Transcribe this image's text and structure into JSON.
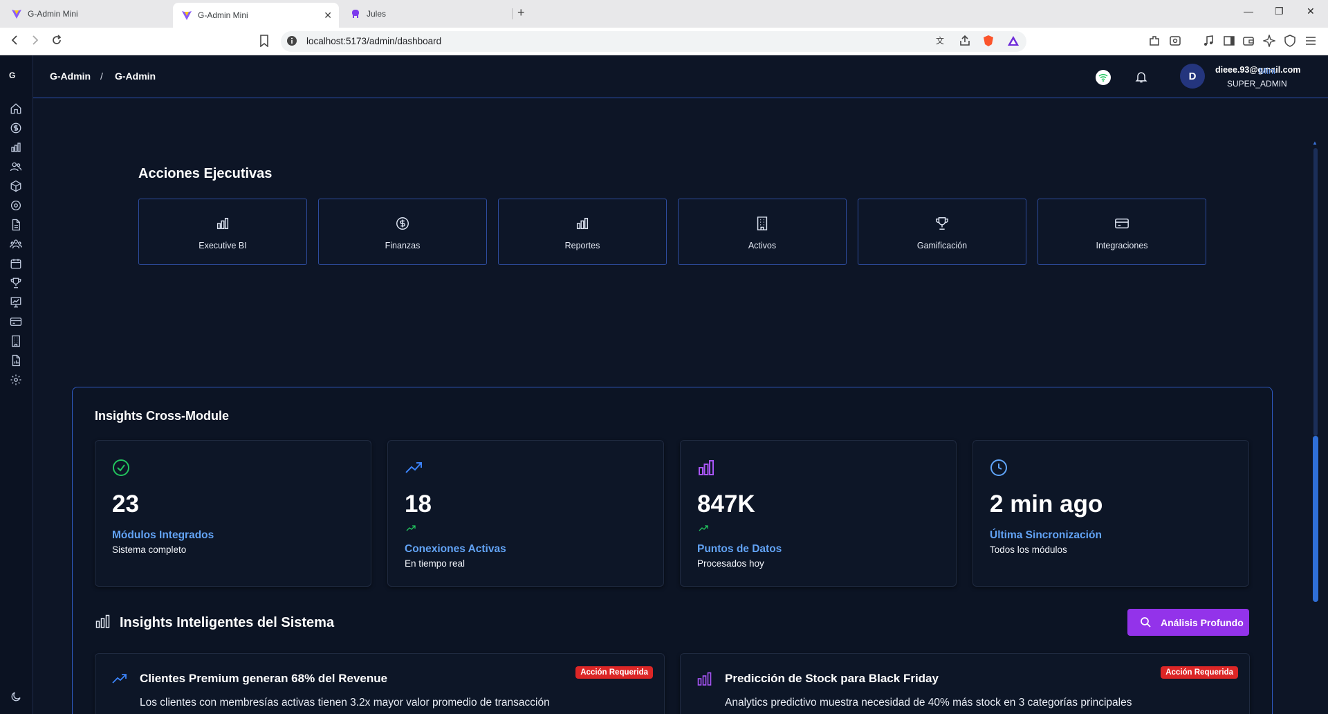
{
  "browser": {
    "tabs": [
      {
        "title": "G-Admin Mini"
      },
      {
        "title": "G-Admin Mini"
      },
      {
        "title": "Jules"
      }
    ],
    "url": "localhost:5173/admin/dashboard"
  },
  "sidebar": {
    "logo": "G"
  },
  "header": {
    "breadcrumb": [
      "G-Admin",
      "/",
      "G-Admin"
    ],
    "user_email": "dieee.93@gmail.com",
    "user_role": "SUPER_ADMIN",
    "avatar_letter": "D",
    "overlay_title": "Mini"
  },
  "actions": {
    "title": "Acciones Ejecutivas",
    "items": [
      {
        "label": "Executive BI",
        "icon": "bar-chart-icon"
      },
      {
        "label": "Finanzas",
        "icon": "dollar-icon"
      },
      {
        "label": "Reportes",
        "icon": "bar-chart-icon"
      },
      {
        "label": "Activos",
        "icon": "building-icon"
      },
      {
        "label": "Gamificación",
        "icon": "trophy-icon"
      },
      {
        "label": "Integraciones",
        "icon": "credit-card-icon"
      }
    ]
  },
  "insights": {
    "title": "Insights Cross-Module",
    "stats": [
      {
        "value": "23",
        "label": "Módulos Integrados",
        "sub": "Sistema completo",
        "icon": "check-circle-icon",
        "color": "#22c55e"
      },
      {
        "value": "18",
        "label": "Conexiones Activas",
        "sub": "En tiempo real",
        "icon": "trending-up-icon",
        "color": "#3b82f6"
      },
      {
        "value": "847K",
        "label": "Puntos de Datos",
        "sub": "Procesados hoy",
        "icon": "bar-chart-icon",
        "color": "#a855f7"
      },
      {
        "value": "2 min ago",
        "label": "Última Sincronización",
        "sub": "Todos los módulos",
        "icon": "clock-icon",
        "color": "#60a5fa"
      }
    ]
  },
  "smart": {
    "title": "Insights Inteligentes del Sistema",
    "button": "Análisis Profundo",
    "cards": [
      {
        "title": "Clientes Premium generan 68% del Revenue",
        "badge": "Acción Requerida",
        "desc": "Los clientes con membresías activas tienen 3.2x mayor valor promedio de transacción",
        "icon": "trending-up-icon"
      },
      {
        "title": "Predicción de Stock para Black Friday",
        "badge": "Acción Requerida",
        "desc": "Analytics predictivo muestra necesidad de 40% más stock en 3 categorías principales",
        "icon": "bar-chart-icon"
      }
    ]
  },
  "colors": {
    "background": "#0d1526",
    "accent_border": "#2f5ac2",
    "button": "#9333ea",
    "badge": "#dc2626",
    "label_blue": "#62a3f5"
  }
}
